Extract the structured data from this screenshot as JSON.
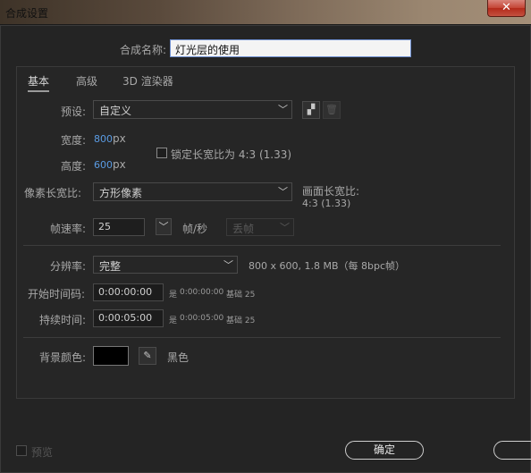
{
  "window": {
    "title": "合成设置",
    "close_glyph": "✕"
  },
  "comp_name": {
    "label": "合成名称:",
    "value": "灯光层的使用"
  },
  "tabs": [
    {
      "label": "基本",
      "active": true
    },
    {
      "label": "高级",
      "active": false
    },
    {
      "label": "3D 渲染器",
      "active": false
    }
  ],
  "preset": {
    "label": "预设:",
    "value": "自定义",
    "new_icon": "new-preset-icon",
    "delete_icon": "trash-icon"
  },
  "width": {
    "label": "宽度:",
    "value": "800",
    "unit": "px"
  },
  "height": {
    "label": "高度:",
    "value": "600",
    "unit": "px"
  },
  "lock_aspect": {
    "label": "锁定长宽比为 4:3 (1.33)",
    "checked": false
  },
  "pixel_aspect": {
    "label": "像素长宽比:",
    "value": "方形像素"
  },
  "frame_aspect": {
    "label": "画面长宽比:",
    "value": "4:3 (1.33)"
  },
  "frame_rate": {
    "label": "帧速率:",
    "value": "25",
    "unit": "帧/秒",
    "drop_label": "丢帧"
  },
  "resolution": {
    "label": "分辨率:",
    "value": "完整",
    "info": "800 x 600, 1.8 MB（每 8bpc帧）"
  },
  "start_timecode": {
    "label": "开始时间码:",
    "value": "0:00:00:00",
    "info_prefix": "是",
    "info_value": "0:00:00:00",
    "info_base": "基础 25"
  },
  "duration": {
    "label": "持续时间:",
    "value": "0:00:05:00",
    "info_prefix": "是",
    "info_value": "0:00:05:00",
    "info_base": "基础 25"
  },
  "background": {
    "label": "背景颜色:",
    "color": "#000000",
    "color_name": "黑色",
    "eyedropper_icon": "eyedropper-icon"
  },
  "footer": {
    "preview_label": "预览",
    "preview_checked": false,
    "ok_label": "确定",
    "cancel_label": ""
  },
  "colors": {
    "accent_blue": "#5a9be3",
    "title_gradient_end": "#a48f78"
  }
}
